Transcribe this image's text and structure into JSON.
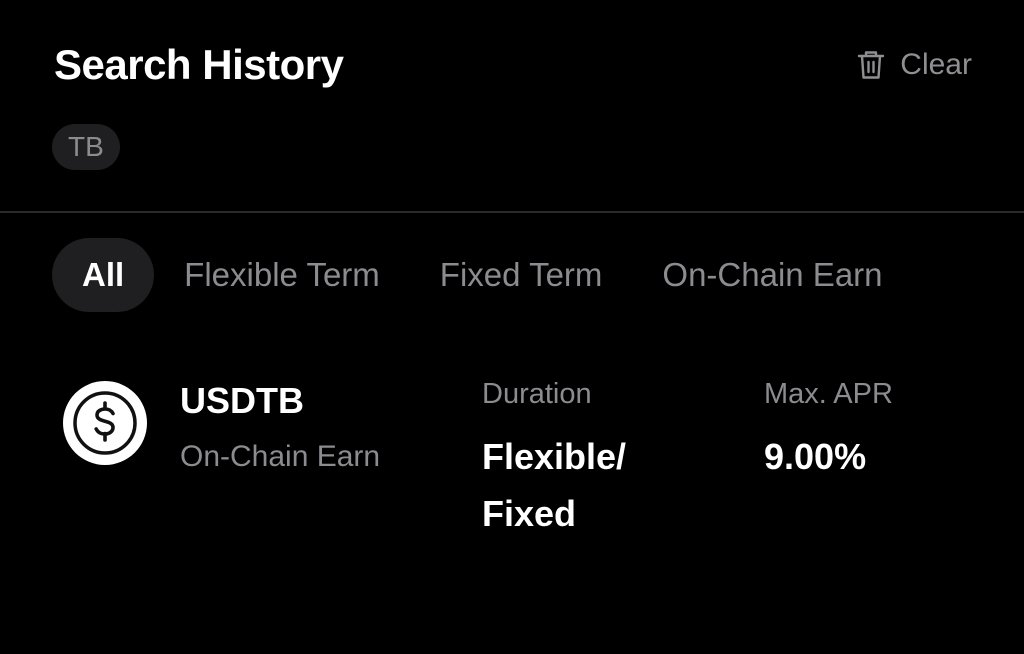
{
  "header": {
    "title": "Search History",
    "clear_label": "Clear",
    "clear_icon": "trash-icon"
  },
  "history_chips": [
    {
      "label": "TB"
    }
  ],
  "tabs": [
    {
      "label": "All",
      "active": true
    },
    {
      "label": "Flexible Term",
      "active": false
    },
    {
      "label": "Fixed Term",
      "active": false
    },
    {
      "label": "On-Chain Earn",
      "active": false
    }
  ],
  "results": [
    {
      "asset": "USDTB",
      "category": "On-Chain Earn",
      "icon": "dollar-coin-icon",
      "duration_label": "Duration",
      "duration_line1": "Flexible/",
      "duration_line2": "Fixed",
      "apr_label": "Max. APR",
      "apr_value": "9.00%"
    }
  ],
  "colors": {
    "background": "#000000",
    "text_primary": "#ffffff",
    "text_secondary": "#8c8c90",
    "chip_background": "#1f1f21",
    "divider": "#2a2a2c"
  }
}
